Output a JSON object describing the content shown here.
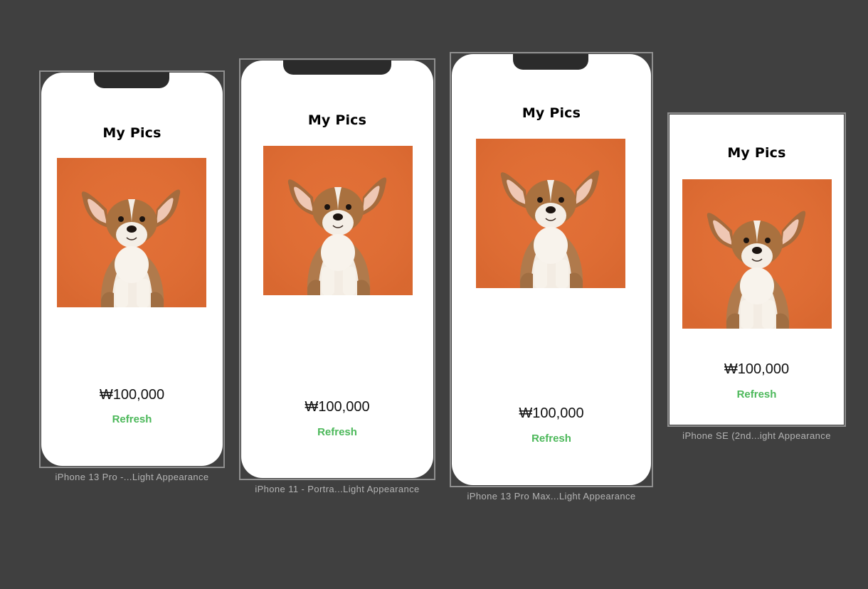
{
  "colors": {
    "canvas_bg": "#404040",
    "device_frame": "#8f8f8f",
    "screen_bg": "#ffffff",
    "notch": "#2b2b2b",
    "accent_green": "#4cb85a",
    "photo_bg": "#e16f36"
  },
  "devices": [
    {
      "caption": "iPhone 13 Pro -...Light Appearance",
      "title": "My Pics",
      "image_icon": "corgi-puppy-photo",
      "price": "₩100,000",
      "refresh_label": "Refresh"
    },
    {
      "caption": "iPhone 11 - Portra...Light Appearance",
      "title": "My Pics",
      "image_icon": "corgi-puppy-photo",
      "price": "₩100,000",
      "refresh_label": "Refresh"
    },
    {
      "caption": "iPhone 13 Pro Max...Light Appearance",
      "title": "My Pics",
      "image_icon": "corgi-puppy-photo",
      "price": "₩100,000",
      "refresh_label": "Refresh"
    },
    {
      "caption": "iPhone SE (2nd...ight Appearance",
      "title": "My Pics",
      "image_icon": "corgi-puppy-photo",
      "price": "₩100,000",
      "refresh_label": "Refresh"
    }
  ]
}
